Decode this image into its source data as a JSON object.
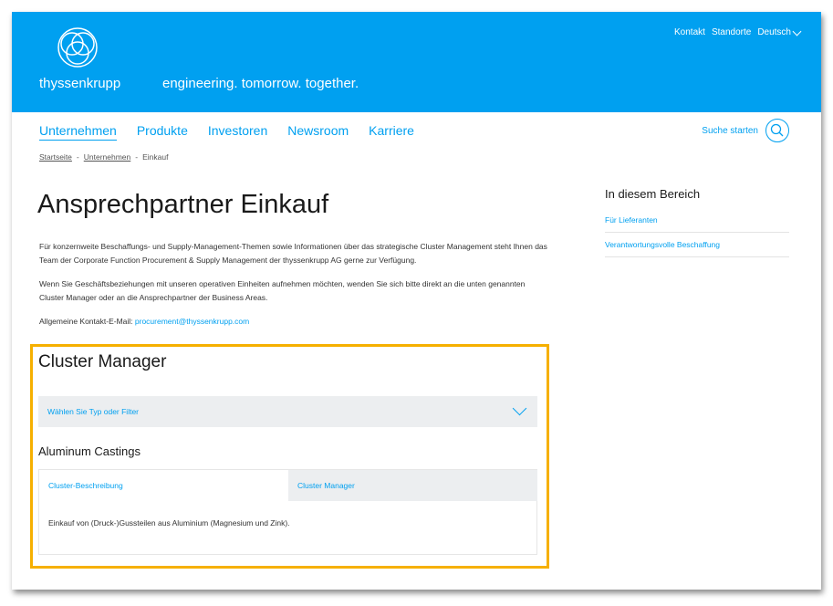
{
  "header": {
    "brand": "thyssenkrupp",
    "slogan": "engineering. tomorrow. together.",
    "utility": [
      "Kontakt",
      "Standorte",
      "Deutsch"
    ]
  },
  "nav": {
    "items": [
      "Unternehmen",
      "Produkte",
      "Investoren",
      "Newsroom",
      "Karriere"
    ],
    "search_label": "Suche starten"
  },
  "breadcrumb": {
    "home": "Startseite",
    "sep": "-",
    "section": "Unternehmen",
    "current": "Einkauf"
  },
  "main": {
    "title": "Ansprechpartner Einkauf",
    "para1": "Für konzernweite Beschaffungs- und Supply-Management-Themen sowie Informationen über das strategische Cluster Management steht Ihnen das Team der Corporate Function Procurement & Supply Management der thyssenkrupp AG gerne zur Verfügung.",
    "para2": "Wenn Sie Geschäftsbeziehungen mit unseren operativen Einheiten aufnehmen möchten, wenden Sie sich bitte direkt an die unten genannten Cluster Manager oder an die Ansprechpartner der Business Areas.",
    "contact_label": "Allgemeine Kontakt-E-Mail:",
    "contact_email": "procurement@thyssenkrupp.com"
  },
  "sidebar": {
    "title": "In diesem Bereich",
    "items": [
      "Für Lieferanten",
      "Verantwortungsvolle Beschaffung"
    ]
  },
  "cluster": {
    "title": "Cluster Manager",
    "filter_placeholder": "Wählen Sie Typ oder Filter",
    "category": "Aluminum Castings",
    "tabs": [
      "Cluster-Beschreibung",
      "Cluster Manager"
    ],
    "description": "Einkauf von (Druck-)Gussteilen aus Aluminium (Magnesium und Zink).",
    "highlight_color": "#f6b000"
  },
  "colors": {
    "brand_blue": "#00a0f0"
  }
}
